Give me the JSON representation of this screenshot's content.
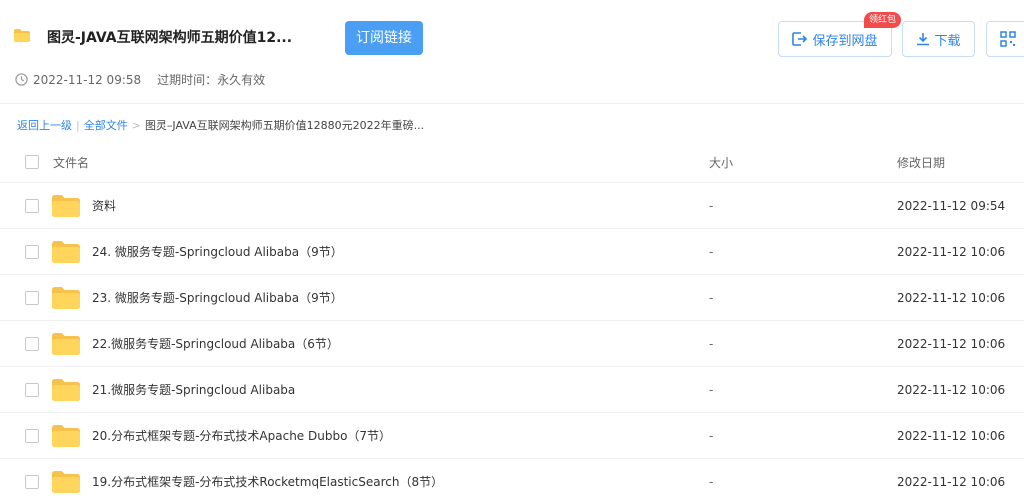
{
  "header": {
    "title": "图灵-JAVA互联网架构师五期价值12...",
    "subscribe_label": "订阅链接",
    "created_time": "2022-11-12 09:58",
    "expire_label": "过期时间：永久有效",
    "save_label": "保存到网盘",
    "download_label": "下载",
    "more_label": "",
    "redpack_badge": "领红包",
    "accent_color": "#2d85e7",
    "primary_button_color": "#4a9ff5"
  },
  "breadcrumb": {
    "back": "返回上一级",
    "all_files": "全部文件",
    "separator": ">",
    "current": "图灵–JAVA互联网架构师五期价值12880元2022年重磅..."
  },
  "table": {
    "columns": {
      "name": "文件名",
      "size": "大小",
      "date": "修改日期"
    },
    "rows": [
      {
        "name": "资料",
        "size": "-",
        "date": "2022-11-12 09:54",
        "icon": "folder-icon"
      },
      {
        "name": "24. 微服务专题-Springcloud Alibaba（9节）",
        "size": "-",
        "date": "2022-11-12 10:06",
        "icon": "folder-icon"
      },
      {
        "name": "23. 微服务专题-Springcloud Alibaba（9节）",
        "size": "-",
        "date": "2022-11-12 10:06",
        "icon": "folder-icon"
      },
      {
        "name": "22.微服务专题-Springcloud Alibaba（6节）",
        "size": "-",
        "date": "2022-11-12 10:06",
        "icon": "folder-icon"
      },
      {
        "name": "21.微服务专题-Springcloud Alibaba",
        "size": "-",
        "date": "2022-11-12 10:06",
        "icon": "folder-icon"
      },
      {
        "name": "20.分布式框架专题-分布式技术Apache Dubbo（7节）",
        "size": "-",
        "date": "2022-11-12 10:06",
        "icon": "folder-icon"
      },
      {
        "name": "19.分布式框架专题-分布式技术RocketmqElasticSearch（8节）",
        "size": "-",
        "date": "2022-11-12 10:06",
        "icon": "folder-icon"
      }
    ]
  }
}
